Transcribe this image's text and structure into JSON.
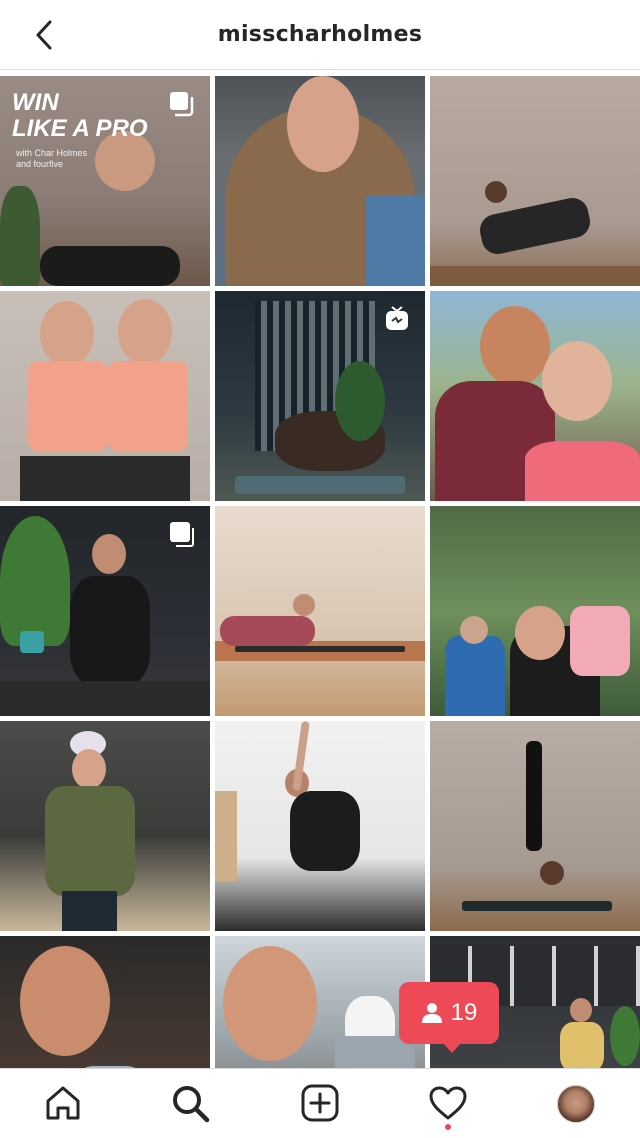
{
  "header": {
    "username": "misscharholmes"
  },
  "posts": [
    {
      "overlay_title_1": "WIN",
      "overlay_title_2": "LIKE A PRO",
      "overlay_sub_1": "with Char Holmes",
      "overlay_sub_2": "and fourfive",
      "badge": "multiple-icon"
    },
    {
      "badge": ""
    },
    {
      "badge": ""
    },
    {
      "badge": ""
    },
    {
      "badge": "igtv-icon"
    },
    {
      "badge": ""
    },
    {
      "badge": "video-icon"
    },
    {
      "badge": ""
    },
    {
      "badge": ""
    },
    {
      "badge": ""
    },
    {
      "badge": ""
    },
    {
      "badge": ""
    },
    {
      "badge": ""
    },
    {
      "badge": ""
    },
    {
      "badge": ""
    }
  ],
  "notification": {
    "icon": "person-icon",
    "count": "19",
    "color": "#ed4956"
  },
  "tabbar": {
    "items": [
      "home-icon",
      "search-icon",
      "new-post-icon",
      "activity-icon",
      "profile-avatar"
    ],
    "active": "search-icon"
  }
}
